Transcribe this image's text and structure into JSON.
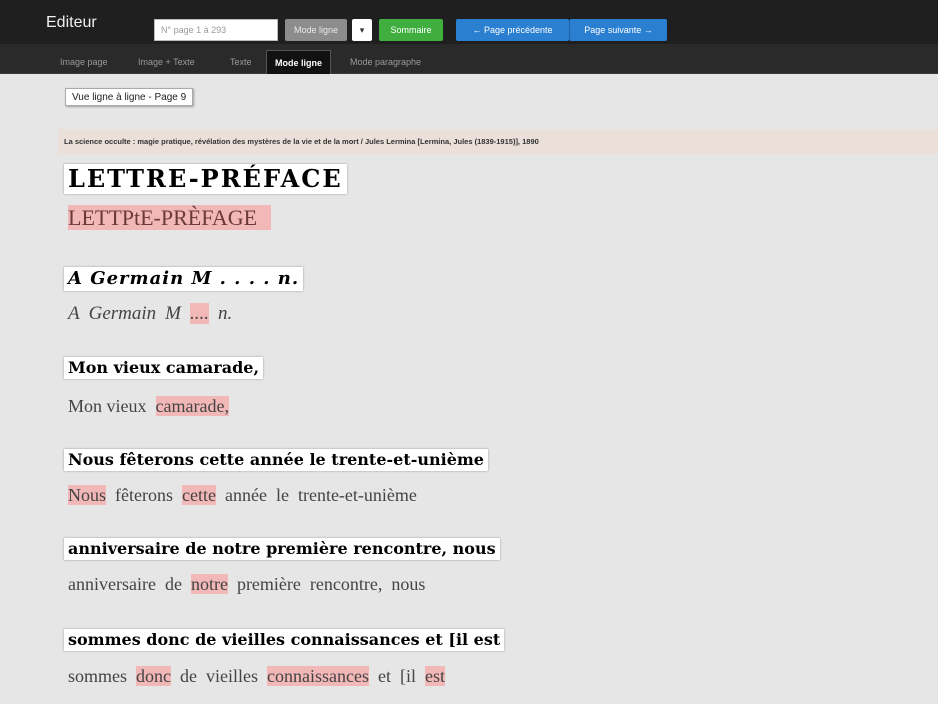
{
  "toolbar": {
    "title": "Editeur",
    "page_input_placeholder": "N° page 1 à 293",
    "mode_select_value": "Mode ligne",
    "sommaire_label": "Sommaire",
    "prev_label": "← Page précédente",
    "next_label": "Page suivante →"
  },
  "tabs": [
    {
      "label": "Image page"
    },
    {
      "label": "Image + Texte"
    },
    {
      "label": "Texte"
    },
    {
      "label": "Mode ligne"
    },
    {
      "label": "Mode paragraphe"
    }
  ],
  "view_label": "Vue ligne à ligne - Page 9",
  "reference": "La science occulte : magie pratique, révélation des mystères de la vie et de la mort / Jules Lermina [Lermina, Jules (1839-1915)], 1890",
  "lines": [
    {
      "scan": "LETTRE-PRÉFACE",
      "ocr": [
        {
          "t": "LETTPtE-PRÈFAGE",
          "err": true
        }
      ]
    },
    {
      "scan": "A Germain M . . . . n.",
      "ocr": [
        {
          "t": "A",
          "err": false
        },
        {
          "t": "Germain",
          "err": false
        },
        {
          "t": "M",
          "err": false
        },
        {
          "t": "....",
          "err": true
        },
        {
          "t": "n.",
          "err": false
        }
      ]
    },
    {
      "scan": "Mon vieux camarade,",
      "ocr": [
        {
          "t": "Mon vieux",
          "err": false
        },
        {
          "t": "camarade,",
          "err": true
        }
      ]
    },
    {
      "scan": "Nous fêterons cette année le trente-et-unième",
      "ocr": [
        {
          "t": "Nous",
          "err": true
        },
        {
          "t": "fêterons",
          "err": false
        },
        {
          "t": "cette",
          "err": true
        },
        {
          "t": "année",
          "err": false
        },
        {
          "t": "le",
          "err": false
        },
        {
          "t": "trente-et-unième",
          "err": false
        }
      ]
    },
    {
      "scan": "anniversaire de notre première rencontre, nous",
      "ocr": [
        {
          "t": "anniversaire",
          "err": false
        },
        {
          "t": "de",
          "err": false
        },
        {
          "t": "notre",
          "err": true
        },
        {
          "t": "première",
          "err": false
        },
        {
          "t": "rencontre,",
          "err": false
        },
        {
          "t": "nous",
          "err": false
        }
      ]
    },
    {
      "scan": "sommes donc de vieilles connaissances et [il est",
      "ocr": [
        {
          "t": "sommes",
          "err": false
        },
        {
          "t": "donc",
          "err": true
        },
        {
          "t": "de",
          "err": false
        },
        {
          "t": "vieilles",
          "err": false
        },
        {
          "t": "connaissances",
          "err": true
        },
        {
          "t": "et",
          "err": false
        },
        {
          "t": "[il",
          "err": false
        },
        {
          "t": "est",
          "err": true
        }
      ]
    }
  ],
  "colors": {
    "error_highlight": "#f2b7b7",
    "sommaire_button": "#3fae3f",
    "nav_button": "#2a7fd0",
    "toolbar_bg": "#1f1f1f"
  }
}
